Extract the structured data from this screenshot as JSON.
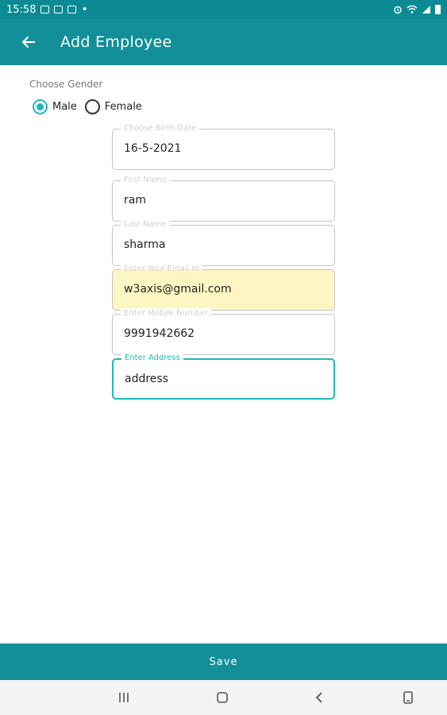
{
  "status_bar": {
    "time": "15:58",
    "dot": "•"
  },
  "header": {
    "title": "Add Employee",
    "back_icon": "arrow-left-icon"
  },
  "gender": {
    "label": "Choose Gender",
    "options": [
      "Male",
      "Female"
    ],
    "selected": "Male"
  },
  "form": {
    "fields": [
      {
        "label": "Choose Birth Date",
        "value": "16-5-2021"
      },
      {
        "label": "First Name",
        "value": "ram"
      },
      {
        "label": "Last Name",
        "value": "sharma"
      },
      {
        "label": "Enter Your Email Id",
        "value": "w3axis@gmail.com"
      },
      {
        "label": "Enter Mobile Number",
        "value": "9991942662"
      },
      {
        "label": "Enter Address",
        "value": "address"
      }
    ]
  },
  "footer": {
    "save_label": "Save"
  },
  "colors": {
    "primary": "#128f99",
    "accent": "#20b7c2",
    "autofill": "#fdf6c3"
  }
}
